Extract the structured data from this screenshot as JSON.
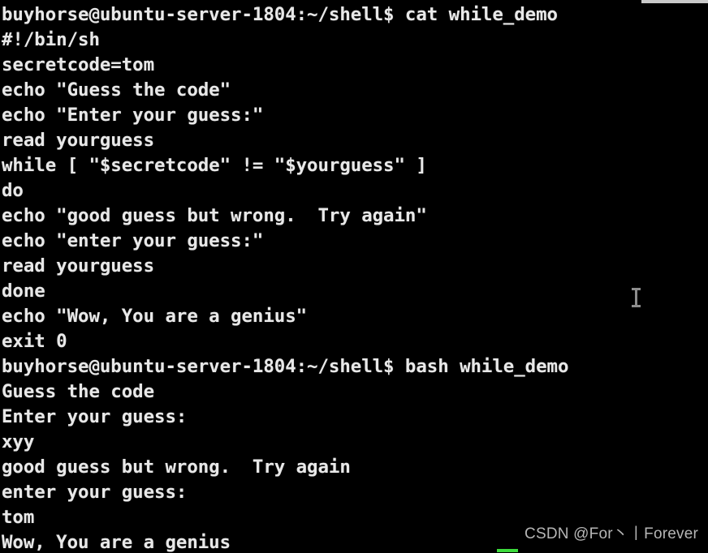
{
  "terminal": {
    "background_color": "#000000",
    "foreground_color": "#e8e8e8",
    "lines": [
      "buyhorse@ubuntu-server-1804:~/shell$ cat while_demo",
      "#!/bin/sh",
      "secretcode=tom",
      "echo \"Guess the code\"",
      "echo \"Enter your guess:\"",
      "read yourguess",
      "while [ \"$secretcode\" != \"$yourguess\" ]",
      "do",
      "echo \"good guess but wrong.  Try again\"",
      "echo \"enter your guess:\"",
      "read yourguess",
      "done",
      "echo \"Wow, You are a genius\"",
      "exit 0",
      "buyhorse@ubuntu-server-1804:~/shell$ bash while_demo",
      "Guess the code",
      "Enter your guess:",
      "xyy",
      "good guess but wrong.  Try again",
      "enter your guess:",
      "tom",
      "Wow, You are a genius"
    ]
  },
  "prompt": {
    "user": "buyhorse",
    "host": "ubuntu-server-1804",
    "path": "~/shell",
    "symbol": "$"
  },
  "commands": {
    "first": "cat while_demo",
    "second": "bash while_demo"
  },
  "script": {
    "filename": "while_demo",
    "shebang": "#!/bin/sh",
    "secret_value": "tom"
  },
  "session_input": {
    "wrong_guess": "xyy",
    "correct_guess": "tom"
  },
  "cursor": {
    "type": "i-beam",
    "color": "#8d8d8d"
  },
  "watermark": {
    "text": "CSDN @For丶丨Forever",
    "color": "#b6b6b6"
  },
  "decorations": {
    "top_bar_color": "#c9c9c9",
    "green_marker_color": "#3cdb3c"
  }
}
